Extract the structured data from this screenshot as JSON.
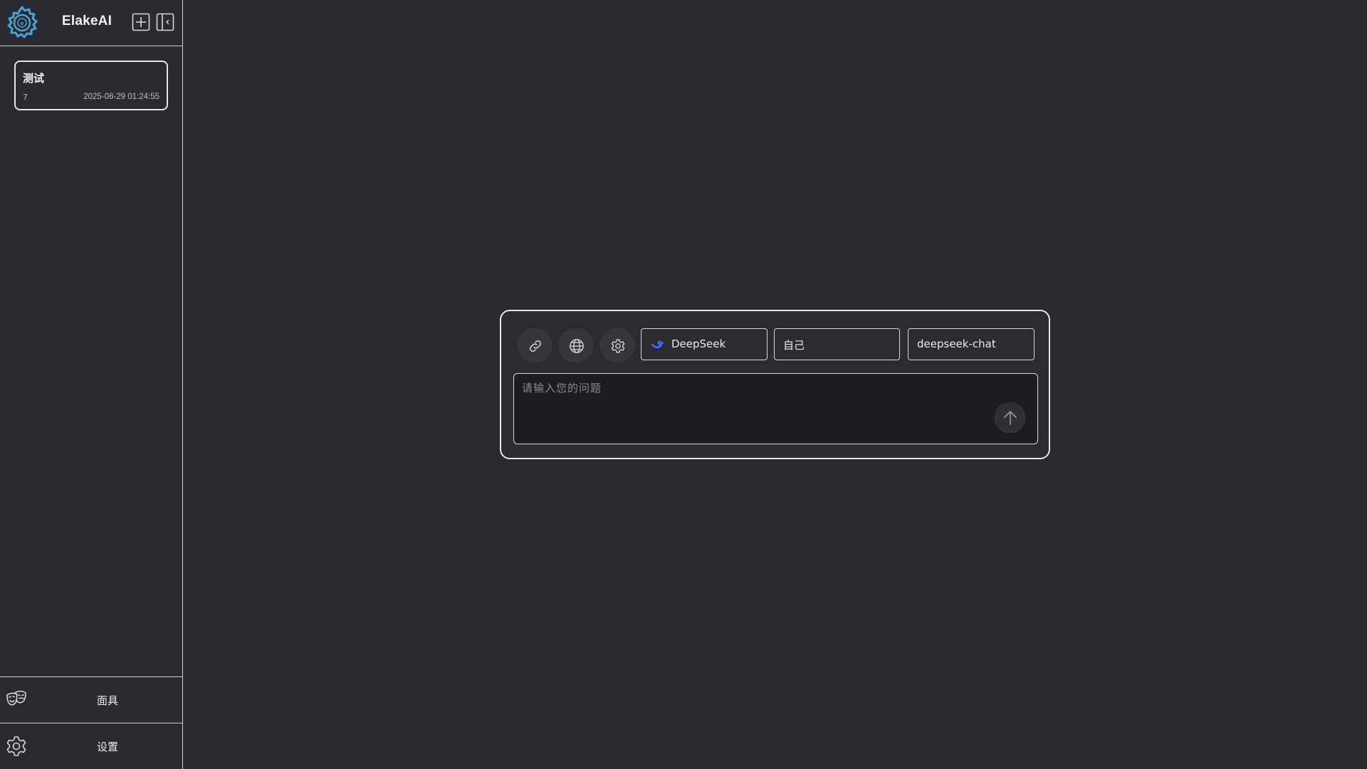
{
  "app": {
    "title": "ElakeAI",
    "accent": "#4aa3d8"
  },
  "sidebar": {
    "header": {
      "new_chat_icon": "plus-square-icon",
      "collapse_icon": "sidebar-collapse-icon"
    },
    "chats": [
      {
        "title": "测试",
        "count": "7",
        "time": "2025-08-29 01:24:55"
      }
    ],
    "bottom": {
      "mask_label": "面具",
      "mask_icon": "theater-mask-icon",
      "settings_label": "设置",
      "settings_icon": "gear-icon"
    }
  },
  "composer": {
    "tools": [
      "link-icon",
      "globe-icon",
      "gear-icon"
    ],
    "provider": "DeepSeek",
    "provider_color": "#4d6bfe",
    "role": "自己",
    "model": "deepseek-chat",
    "input_placeholder": "请输入您的问题",
    "input_value": "",
    "send_icon": "arrow-up-icon"
  }
}
